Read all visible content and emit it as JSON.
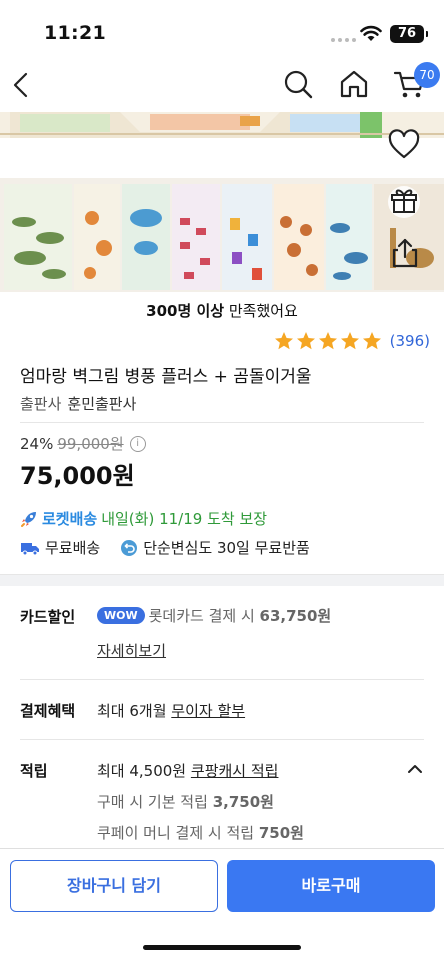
{
  "status": {
    "time": "11:21",
    "battery": "76"
  },
  "nav": {
    "cart_count": "70"
  },
  "product": {
    "satisfied_bold": "300명 이상",
    "satisfied_rest": " 만족했어요",
    "rating_stars": 5,
    "review_count": "(396)",
    "title": "엄마랑 벽그림 병풍 플러스 + 곰돌이거울",
    "publisher_label": "출판사",
    "publisher": "훈민출판사",
    "discount_pct": "24%",
    "original_price": "99,000원",
    "info_icon": "i",
    "price": "75,000원"
  },
  "delivery": {
    "rocket_brand": "로켓배송",
    "rocket_text": " 내일(화) 11/19 도착 보장",
    "free_shipping": "무료배송",
    "free_return": "단순변심도 30일 무료반품"
  },
  "benefits": {
    "card_label": "카드할인",
    "wow_badge": "WOW",
    "card_text": "롯데카드 결제 시 ",
    "card_price": "63,750원",
    "details_link": "자세히보기",
    "payment_label": "결제혜택",
    "payment_text": "최대 6개월 ",
    "payment_link": "무이자 할부",
    "reward_label": "적립",
    "reward_text": "최대 4,500원 ",
    "reward_link": "쿠팡캐시 적립",
    "reward_basic": "구매 시 기본 적립 ",
    "reward_basic_amt": "3,750원",
    "reward_money": "쿠페이 머니 결제 시 적립 ",
    "reward_money_amt": "750원"
  },
  "actions": {
    "add_to_cart": "장바구니 담기",
    "buy_now": "바로구매"
  },
  "colors": {
    "accent": "#3a78f2",
    "rating": "#3166d8",
    "rocket_green": "#2f9a39",
    "star": "#f5a623"
  },
  "icons": [
    "back-arrow-icon",
    "search-icon",
    "home-icon",
    "cart-icon",
    "heart-icon",
    "gift-icon",
    "share-icon",
    "info-icon",
    "rocket-icon",
    "truck-icon",
    "return-icon",
    "chevron-up-icon"
  ]
}
